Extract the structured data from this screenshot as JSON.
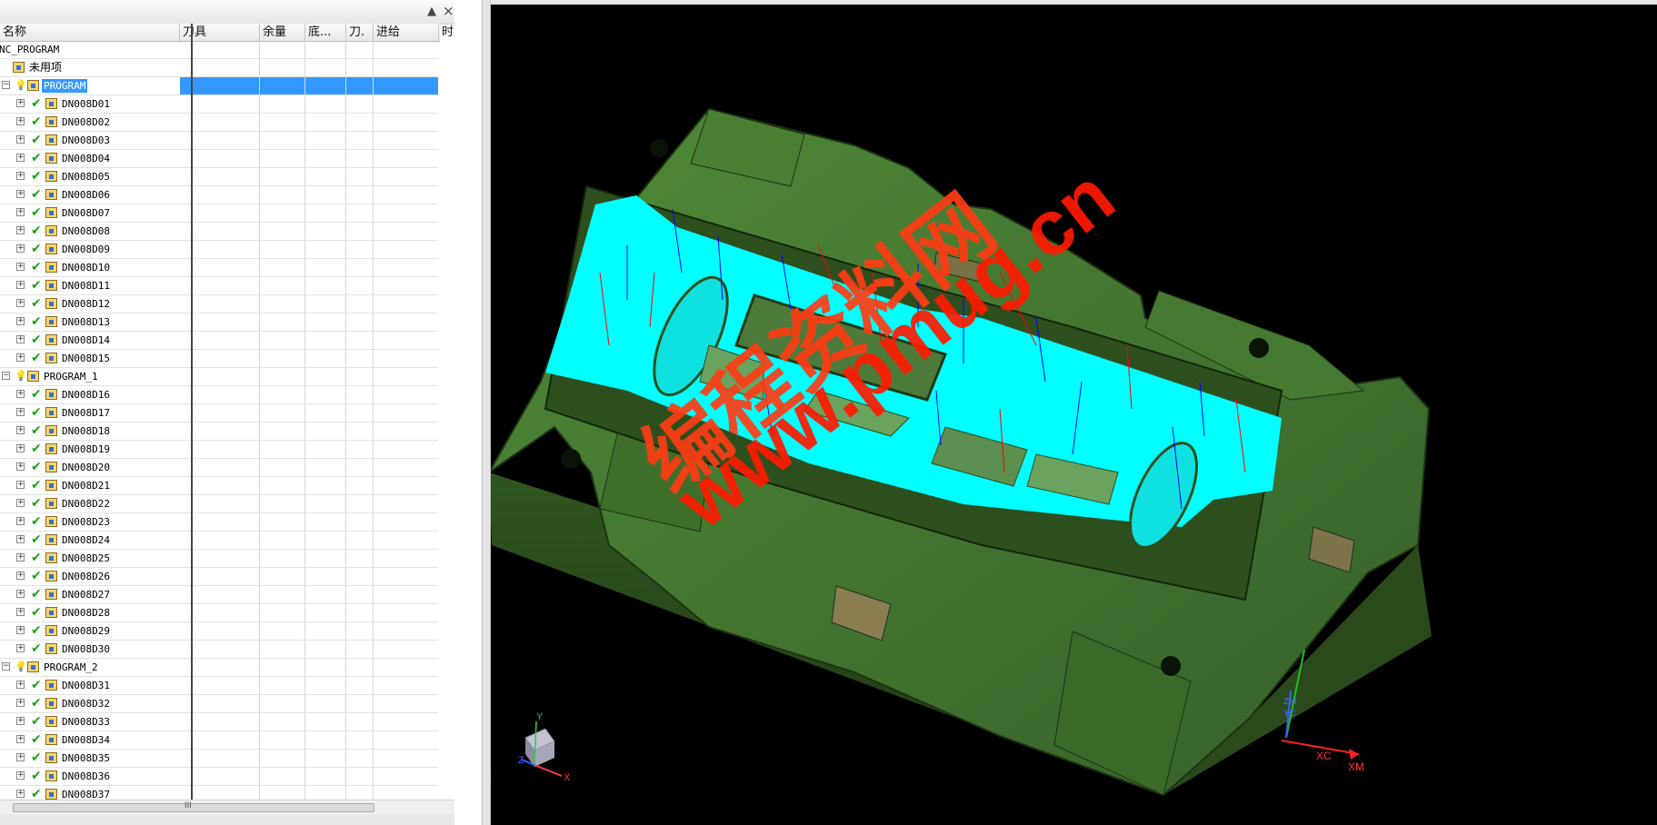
{
  "navigator": {
    "topbar_arrow": "▲",
    "topbar_close": "×",
    "columns": [
      "名称",
      "刀具",
      "余量",
      "底...",
      "刀.",
      "进给",
      "时"
    ],
    "rows": [
      {
        "label": "NC_PROGRAM",
        "type": "root",
        "level": 0
      },
      {
        "label": "未用项",
        "type": "unused",
        "level": 1
      },
      {
        "label": "PROGRAM",
        "type": "group",
        "level": 1,
        "selected": true
      },
      {
        "label": "DN008D01",
        "type": "op",
        "level": 2
      },
      {
        "label": "DN008D02",
        "type": "op",
        "level": 2
      },
      {
        "label": "DN008D03",
        "type": "op",
        "level": 2
      },
      {
        "label": "DN008D04",
        "type": "op",
        "level": 2
      },
      {
        "label": "DN008D05",
        "type": "op",
        "level": 2
      },
      {
        "label": "DN008D06",
        "type": "op",
        "level": 2
      },
      {
        "label": "DN008D07",
        "type": "op",
        "level": 2
      },
      {
        "label": "DN008D08",
        "type": "op",
        "level": 2
      },
      {
        "label": "DN008D09",
        "type": "op",
        "level": 2
      },
      {
        "label": "DN008D10",
        "type": "op",
        "level": 2
      },
      {
        "label": "DN008D11",
        "type": "op",
        "level": 2
      },
      {
        "label": "DN008D12",
        "type": "op",
        "level": 2
      },
      {
        "label": "DN008D13",
        "type": "op",
        "level": 2
      },
      {
        "label": "DN008D14",
        "type": "op",
        "level": 2
      },
      {
        "label": "DN008D15",
        "type": "op",
        "level": 2
      },
      {
        "label": "PROGRAM_1",
        "type": "group",
        "level": 1
      },
      {
        "label": "DN008D16",
        "type": "op",
        "level": 2
      },
      {
        "label": "DN008D17",
        "type": "op",
        "level": 2
      },
      {
        "label": "DN008D18",
        "type": "op",
        "level": 2
      },
      {
        "label": "DN008D19",
        "type": "op",
        "level": 2
      },
      {
        "label": "DN008D20",
        "type": "op",
        "level": 2
      },
      {
        "label": "DN008D21",
        "type": "op",
        "level": 2
      },
      {
        "label": "DN008D22",
        "type": "op",
        "level": 2
      },
      {
        "label": "DN008D23",
        "type": "op",
        "level": 2
      },
      {
        "label": "DN008D24",
        "type": "op",
        "level": 2
      },
      {
        "label": "DN008D25",
        "type": "op",
        "level": 2
      },
      {
        "label": "DN008D26",
        "type": "op",
        "level": 2
      },
      {
        "label": "DN008D27",
        "type": "op",
        "level": 2
      },
      {
        "label": "DN008D28",
        "type": "op",
        "level": 2
      },
      {
        "label": "DN008D29",
        "type": "op",
        "level": 2
      },
      {
        "label": "DN008D30",
        "type": "op",
        "level": 2
      },
      {
        "label": "PROGRAM_2",
        "type": "group",
        "level": 1
      },
      {
        "label": "DN008D31",
        "type": "op",
        "level": 2
      },
      {
        "label": "DN008D32",
        "type": "op",
        "level": 2
      },
      {
        "label": "DN008D33",
        "type": "op",
        "level": 2
      },
      {
        "label": "DN008D34",
        "type": "op",
        "level": 2
      },
      {
        "label": "DN008D35",
        "type": "op",
        "level": 2
      },
      {
        "label": "DN008D36",
        "type": "op",
        "level": 2
      },
      {
        "label": "DN008D37",
        "type": "op",
        "level": 2
      }
    ],
    "hscroll_grip": "III"
  },
  "viewport": {
    "watermark_cn": "编程资料网",
    "watermark_url": "www.pmug.cn",
    "triad": {
      "x": "X",
      "y": "Y",
      "z": "Z"
    },
    "wcs": {
      "xc": "XC",
      "xm": "XM",
      "zm": "ZM",
      "yc": "YC"
    },
    "colors": {
      "background": "#000000",
      "part": "#3e6b2a",
      "toolpath_surface": "#00ffff",
      "watermark": "#ff3c14"
    }
  }
}
